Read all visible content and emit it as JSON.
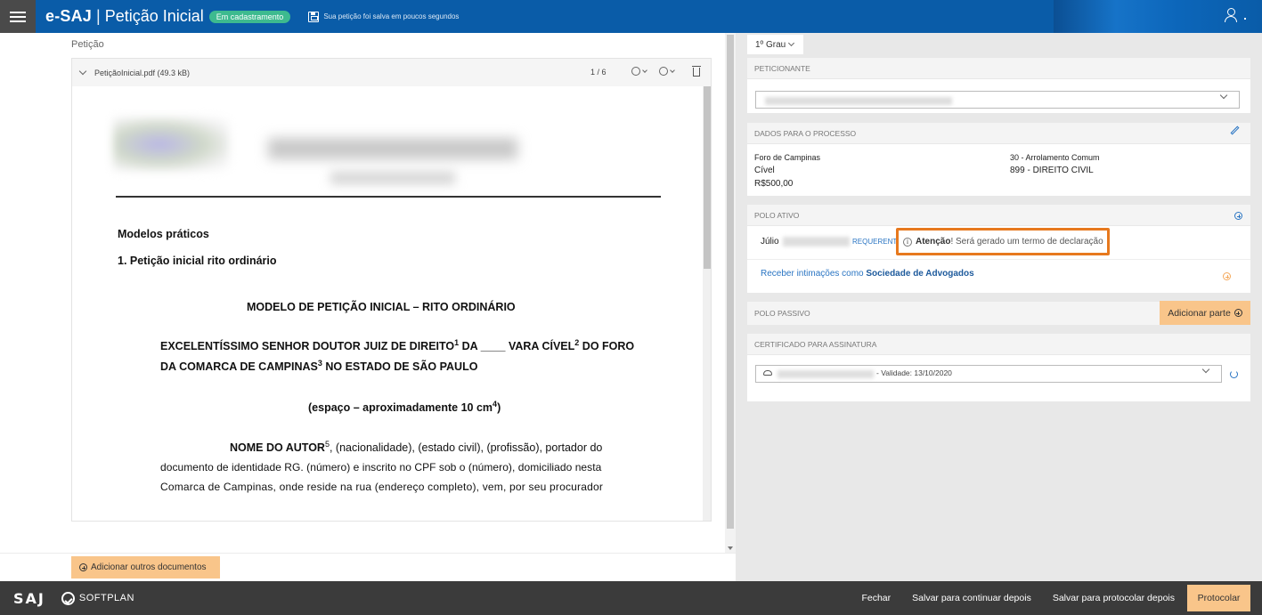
{
  "header": {
    "brand": "e-SAJ",
    "separator": "|",
    "title": "Petição Inicial",
    "status_badge": "Em cadastramento",
    "save_status": "Sua petição foi salva em poucos segundos",
    "menu_icon": "hamburger-icon",
    "save_icon": "floppy-disk-icon",
    "user_icon": "user-icon"
  },
  "left": {
    "section_label": "Petição",
    "document": {
      "file_name": "PetiçãoInicial.pdf (49.3 kB)",
      "page_indicator": "1 / 6"
    },
    "doc_content": {
      "heading_models": "Modelos práticos",
      "heading_item": "1. Petição inicial rito ordinário",
      "title": "MODELO DE PETIÇÃO INICIAL – RITO ORDINÁRIO",
      "addr_line1_a": "EXCELENTÍSSIMO SENHOR DOUTOR JUIZ DE DIREITO",
      "addr_sup1": "1",
      "addr_line1_b": " DA ____ VARA CÍVEL",
      "addr_sup2": "2",
      "addr_line1_c": " DO FORO",
      "addr_line2_a": "DA COMARCA DE CAMPINAS",
      "addr_sup3": "3",
      "addr_line2_b": " NO ESTADO DE SÃO PAULO",
      "space_note_a": "(espaço – aproximadamente 10 cm",
      "space_sup": "4",
      "space_note_b": ")",
      "body_bold": "NOME DO AUTOR",
      "body_sup": "5",
      "body_line1": ", (nacionalidade), (estado civil), (profissão), portador do",
      "body_line2": "documento de identidade RG. (número) e inscrito no CPF sob o (número), domiciliado nesta",
      "body_line3": "Comarca de Campinas, onde reside na rua (endereço completo), vem, por seu procurador"
    },
    "add_docs_label": "Adicionar outros documentos"
  },
  "right": {
    "grau_tab": "1º Grau",
    "peticionante_header": "PETICIONANTE",
    "dados_header": "DADOS PARA O PROCESSO",
    "dados": {
      "foro": "Foro de Campinas",
      "area": "Cível",
      "valor": "R$500,00",
      "classe": "30 - Arrolamento Comum",
      "assunto": "899 - DIREITO CIVIL"
    },
    "polo_ativo_header": "POLO ATIVO",
    "polo_ativo": {
      "party_name": "Júlio",
      "party_role": "REQUERENTE",
      "attention_bold": "Atenção",
      "attention_text": "! Será gerado um termo de declaração",
      "intimacoes_prefix": "Receber intimações como ",
      "intimacoes_bold": "Sociedade de Advogados"
    },
    "polo_passivo_header": "POLO PASSIVO",
    "add_part_label": "Adicionar parte",
    "certificado_header": "CERTIFICADO PARA ASSINATURA",
    "certificado_validity": "- Validade: 13/10/2020"
  },
  "footer": {
    "logo": "SAJ",
    "softplan": "SOFTPLAN",
    "actions": {
      "close": "Fechar",
      "save_continue": "Salvar para continuar depois",
      "save_protocol": "Salvar para protocolar depois",
      "protocol": "Protocolar"
    }
  },
  "colors": {
    "header_blue": "#0a5ca8",
    "badge_green": "#3dba8f",
    "accent_orange": "#f9c58a",
    "attention_border": "#e7791e",
    "link_blue": "#2a75c3",
    "footer_dark": "#3b3b3b"
  }
}
